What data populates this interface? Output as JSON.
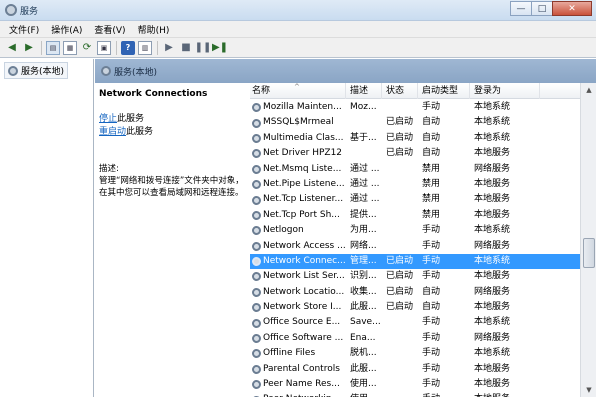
{
  "window": {
    "title": "服务",
    "buttons": [
      "—",
      "□",
      "✕"
    ]
  },
  "menu": [
    "文件(F)",
    "操作(A)",
    "查看(V)",
    "帮助(H)"
  ],
  "left_pane": {
    "item": "服务(本地)"
  },
  "right_pane": {
    "header": "服务(本地)",
    "selected_service": "Network Connections",
    "stop_link": "停止",
    "stop_rest": "此服务",
    "restart_link": "重启动",
    "restart_rest": "此服务",
    "desc_label": "描述:",
    "desc_text": "管理“网络和拨号连接”文件夹中对象，在其中您可以查看局域网和远程连接。"
  },
  "table": {
    "columns": [
      "名称",
      "描述",
      "状态",
      "启动类型",
      "登录为"
    ],
    "selected_index": 10,
    "scroll_position": 0.55,
    "rows": [
      [
        "Mozilla Mainten...",
        "Moz...",
        "",
        "手动",
        "本地系统"
      ],
      [
        "MSSQL$Mrmeal",
        "",
        "已启动",
        "自动",
        "本地系统"
      ],
      [
        "Multimedia Clas...",
        "基于...",
        "已启动",
        "自动",
        "本地系统"
      ],
      [
        "Net Driver HPZ12",
        "",
        "已启动",
        "自动",
        "本地服务"
      ],
      [
        "Net.Msmq Liste...",
        "通过 ...",
        "",
        "禁用",
        "网络服务"
      ],
      [
        "Net.Pipe Listene...",
        "通过 ...",
        "",
        "禁用",
        "本地服务"
      ],
      [
        "Net.Tcp Listener...",
        "通过 ...",
        "",
        "禁用",
        "本地服务"
      ],
      [
        "Net.Tcp Port Sh...",
        "提供...",
        "",
        "禁用",
        "本地服务"
      ],
      [
        "Netlogon",
        "为用...",
        "",
        "手动",
        "本地系统"
      ],
      [
        "Network Access ...",
        "网络...",
        "",
        "手动",
        "网络服务"
      ],
      [
        "Network Connec...",
        "管理...",
        "已启动",
        "手动",
        "本地系统"
      ],
      [
        "Network List Ser...",
        "识别...",
        "已启动",
        "手动",
        "本地服务"
      ],
      [
        "Network Locatio...",
        "收集...",
        "已启动",
        "自动",
        "网络服务"
      ],
      [
        "Network Store I...",
        "此服...",
        "已启动",
        "自动",
        "本地服务"
      ],
      [
        "Office  Source E...",
        "Save...",
        "",
        "手动",
        "本地系统"
      ],
      [
        "Office Software ...",
        "Ena...",
        "",
        "手动",
        "网络服务"
      ],
      [
        "Offline Files",
        "脱机...",
        "",
        "手动",
        "本地系统"
      ],
      [
        "Parental Controls",
        "此服...",
        "",
        "手动",
        "本地服务"
      ],
      [
        "Peer Name Res...",
        "使用...",
        "",
        "手动",
        "本地服务"
      ],
      [
        "Peer Networkin...",
        "使用...",
        "",
        "手动",
        "本地服务"
      ]
    ]
  }
}
